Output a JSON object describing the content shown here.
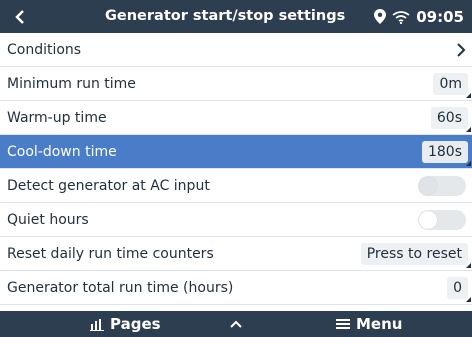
{
  "header": {
    "title": "Generator start/stop settings",
    "time": "09:05"
  },
  "rows": [
    {
      "label": "Conditions"
    },
    {
      "label": "Minimum run time",
      "value": "0m"
    },
    {
      "label": "Warm-up time",
      "value": "60s"
    },
    {
      "label": "Cool-down time",
      "value": "180s"
    },
    {
      "label": "Detect generator at AC input",
      "toggle": "off"
    },
    {
      "label": "Quiet hours",
      "toggle": "off"
    },
    {
      "label": "Reset daily run time counters",
      "value": "Press to reset"
    },
    {
      "label": "Generator total run time (hours)",
      "value": "0"
    }
  ],
  "footer": {
    "pages_label": "Pages",
    "menu_label": "Menu"
  },
  "colors": {
    "bar": "#2c3e4f",
    "selected": "#4a7dc8"
  }
}
